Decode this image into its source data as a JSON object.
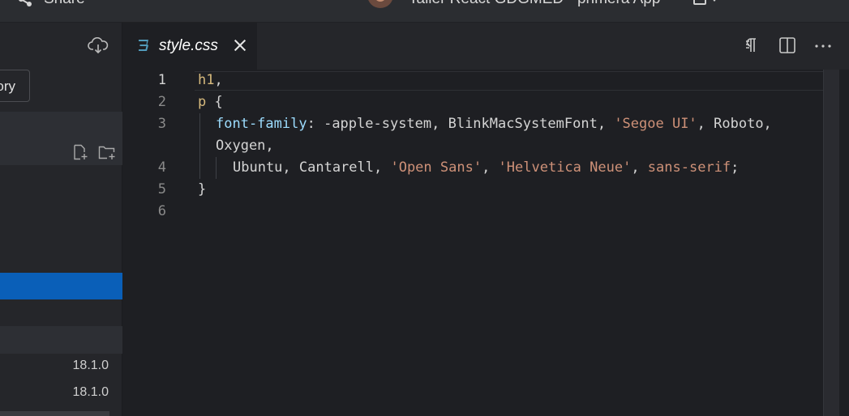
{
  "window": {
    "share_label": "Share",
    "title": "Taller React GDGMED - primera App"
  },
  "sidebar": {
    "history_label": "History",
    "history_visible": "ory",
    "dependencies": [
      {
        "version": "18.1.0"
      },
      {
        "version": "18.1.0"
      }
    ]
  },
  "tab": {
    "label": "style.css",
    "icon": "css-file-icon",
    "active": true
  },
  "editor_actions": [
    "pilcrow-icon",
    "split-editor-icon",
    "more-actions-icon"
  ],
  "editor": {
    "line_numbers": [
      "1",
      "2",
      "3",
      "",
      "4",
      "5",
      "6"
    ],
    "lines": {
      "l1": {
        "selector": "h1",
        "punct": ","
      },
      "l2": {
        "selector": "p",
        "punct": " {"
      },
      "l3a": {
        "prop": "font-family",
        "colon": ": ",
        "v1": "-apple-system, BlinkMacSystemFont, ",
        "s1": "'Segoe UI'",
        "v2": ", Roboto,"
      },
      "l3b": {
        "v": "Oxygen,"
      },
      "l4": {
        "v1": "Ubuntu, Cantarell, ",
        "s1": "'Open Sans'",
        "c1": ", ",
        "s2": "'Helvetica Neue'",
        "c2": ", ",
        "kw": "sans-serif",
        "end": ";"
      },
      "l5": {
        "v": "}"
      }
    }
  },
  "colors": {
    "selector": "#d7ba7d",
    "property": "#9cdcfe",
    "string": "#ce9178",
    "selection": "#0a5fb8",
    "css_icon": "#519aba"
  }
}
